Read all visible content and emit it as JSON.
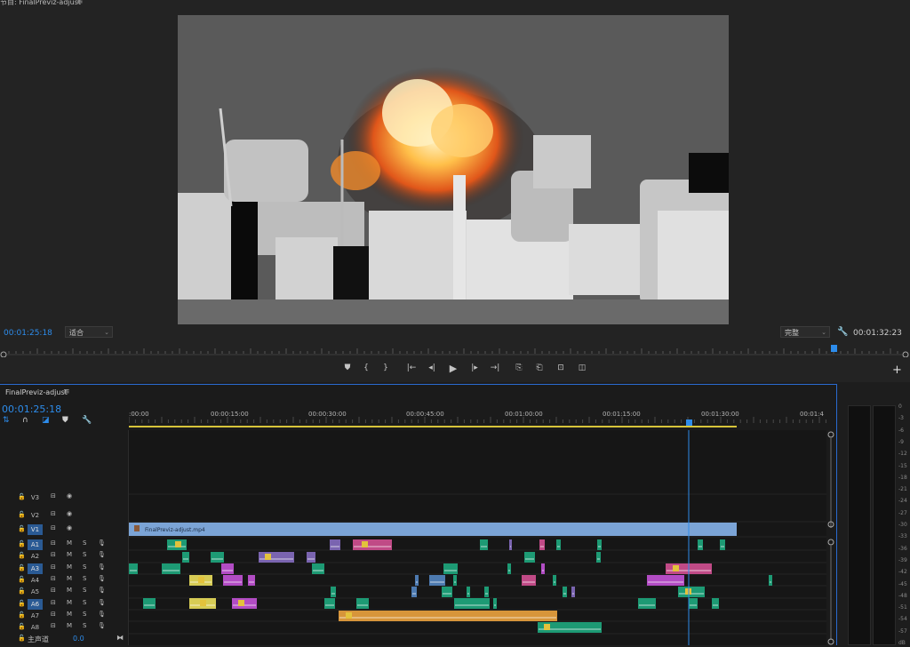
{
  "monitor": {
    "title": "节目: FinalPreviz-adjust",
    "menu_icon": "≡",
    "current_tc": "00:01:25:18",
    "zoom": "适合",
    "quality": "完整",
    "duration": "00:01:32:23"
  },
  "transport_icons": [
    "marker-icon",
    "mark-in-icon",
    "mark-out-icon",
    "go-to-in-icon",
    "step-back-icon",
    "play-icon",
    "step-forward-icon",
    "go-to-out-icon",
    "lift-icon",
    "extract-icon",
    "export-frame-icon",
    "compare-icon"
  ],
  "timeline": {
    "sequence": "FinalPreviz-adjust",
    "menu_icon": "≡",
    "current_tc": "00:01:25:18",
    "ruler_labels": [
      ":00:00",
      "00:00:15:00",
      "00:00:30:00",
      "00:00:45:00",
      "00:01:00:00",
      "00:01:15:00",
      "00:01:30:00",
      "00:01:4"
    ],
    "video_clip_name": "FinalPreviz-adjust.mp4",
    "tracks": [
      {
        "name": "V3",
        "b1": "⊟",
        "b2": "◉"
      },
      {
        "name": "V2",
        "b1": "⊟",
        "b2": "◉"
      },
      {
        "name": "V1",
        "b1": "⊟",
        "b2": "◉",
        "on": true
      },
      {
        "name": "A1",
        "b1": "⊟",
        "b2": "M",
        "b3": "S",
        "b4": "🎙",
        "on": true
      },
      {
        "name": "A2",
        "b1": "⊟",
        "b2": "M",
        "b3": "S",
        "b4": "🎙"
      },
      {
        "name": "A3",
        "b1": "⊟",
        "b2": "M",
        "b3": "S",
        "b4": "🎙",
        "on": true
      },
      {
        "name": "A4",
        "b1": "⊟",
        "b2": "M",
        "b3": "S",
        "b4": "🎙"
      },
      {
        "name": "A5",
        "b1": "⊟",
        "b2": "M",
        "b3": "S",
        "b4": "🎙"
      },
      {
        "name": "A6",
        "b1": "⊟",
        "b2": "M",
        "b3": "S",
        "b4": "🎙",
        "on": true
      },
      {
        "name": "A7",
        "b1": "⊟",
        "b2": "M",
        "b3": "S",
        "b4": "🎙"
      },
      {
        "name": "A8",
        "b1": "⊟",
        "b2": "M",
        "b3": "S",
        "b4": "🎙"
      }
    ],
    "master_label": "主声道",
    "master_value": "0.0"
  },
  "meter_scale": [
    "0",
    "-3",
    "-6",
    "-9",
    "-12",
    "-15",
    "-18",
    "-21",
    "-24",
    "-27",
    "-30",
    "-33",
    "-36",
    "-39",
    "-42",
    "-45",
    "-48",
    "-51",
    "-54",
    "-57",
    "dB"
  ],
  "colors": {
    "accent": "#2d8ceb",
    "v1_clip": "#7ba4d6",
    "green": "#1d9a74",
    "purple": "#7a64b0",
    "pink": "#c04a86",
    "magenta": "#b24cc4",
    "yellow": "#d7cc55",
    "orange": "#d7953a",
    "blue": "#4d7ab0"
  }
}
